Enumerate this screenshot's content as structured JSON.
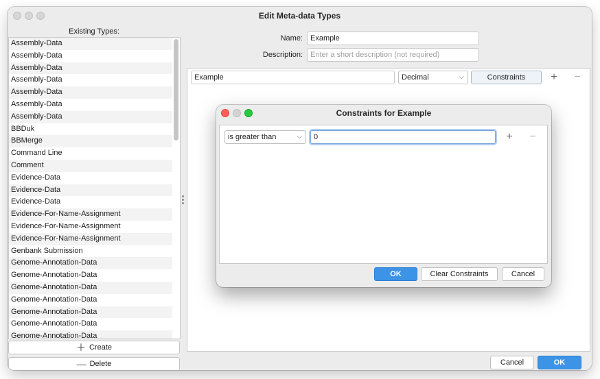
{
  "window": {
    "title": "Edit Meta-data Types"
  },
  "sidebar": {
    "title": "Existing Types:",
    "items": [
      "Assembly-Data",
      "Assembly-Data",
      "Assembly-Data",
      "Assembly-Data",
      "Assembly-Data",
      "Assembly-Data",
      "Assembly-Data",
      "BBDuk",
      "BBMerge",
      "Command Line",
      "Comment",
      "Evidence-Data",
      "Evidence-Data",
      "Evidence-Data",
      "Evidence-For-Name-Assignment",
      "Evidence-For-Name-Assignment",
      "Evidence-For-Name-Assignment",
      "Genbank Submission",
      "Genome-Annotation-Data",
      "Genome-Annotation-Data",
      "Genome-Annotation-Data",
      "Genome-Annotation-Data",
      "Genome-Annotation-Data",
      "Genome-Annotation-Data",
      "Genome-Annotation-Data"
    ],
    "create_label": "Create",
    "delete_label": "Delete"
  },
  "form": {
    "name_label": "Name:",
    "name_value": "Example",
    "description_label": "Description:",
    "description_placeholder": "Enter a short description (not required)"
  },
  "field_row": {
    "field_name": "Example",
    "type": "Decimal",
    "constraints_label": "Constraints"
  },
  "footer": {
    "cancel_label": "Cancel",
    "ok_label": "OK"
  },
  "dialog": {
    "title": "Constraints for Example",
    "condition": "is greater than",
    "value": "0",
    "ok_label": "OK",
    "clear_label": "Clear Constraints",
    "cancel_label": "Cancel"
  },
  "icons": {
    "add": "plus-icon",
    "remove": "minus-icon",
    "dropdown": "chevron-down-icon"
  },
  "colors": {
    "primary_button": "#3d93e6",
    "close_light": "#fe5f57",
    "zoom_light": "#28c840"
  }
}
